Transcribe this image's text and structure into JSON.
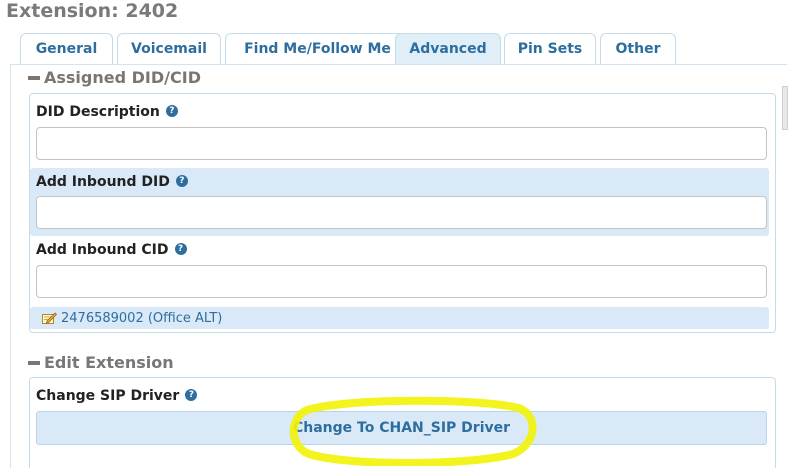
{
  "page": {
    "title": "Extension: 2402"
  },
  "tabs": [
    {
      "label": "General",
      "active": false
    },
    {
      "label": "Voicemail",
      "active": false
    },
    {
      "label": "Find Me/Follow Me",
      "active": false
    },
    {
      "label": "Advanced",
      "active": true
    },
    {
      "label": "Pin Sets",
      "active": false
    },
    {
      "label": "Other",
      "active": false
    }
  ],
  "assigned_did_cid": {
    "header": "Assigned DID/CID",
    "did_description": {
      "label": "DID Description",
      "value": "",
      "placeholder": ""
    },
    "add_inbound_did": {
      "label": "Add Inbound DID",
      "value": "",
      "placeholder": ""
    },
    "add_inbound_cid": {
      "label": "Add Inbound CID",
      "value": "",
      "placeholder": ""
    },
    "entries": [
      {
        "text": "2476589002 (Office ALT)",
        "icon": "edit-icon"
      }
    ]
  },
  "edit_extension": {
    "header": "Edit Extension",
    "change_sip_driver": {
      "label": "Change SIP Driver",
      "button_label": "Change To CHAN_SIP Driver"
    }
  },
  "icons": {
    "help": "help-icon",
    "collapse": "minus-icon"
  },
  "help_glyph": "?",
  "colors": {
    "accent": "#2e6e9e",
    "band": "#d9e9f7",
    "highlight": "#f2f20a",
    "title": "#7a7a7a"
  }
}
